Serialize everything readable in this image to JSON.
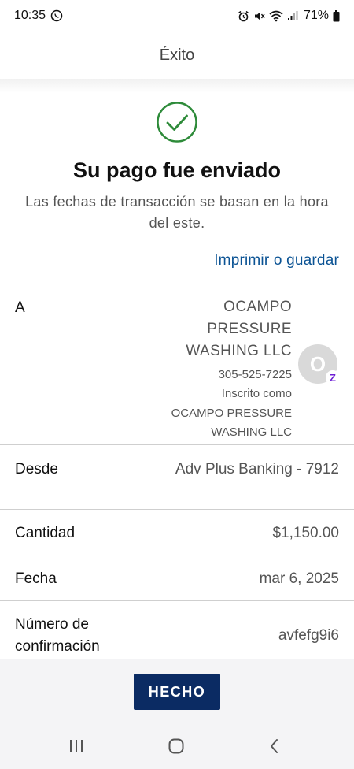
{
  "status_bar": {
    "time": "10:35",
    "battery": "71%"
  },
  "header": {
    "title": "Éxito"
  },
  "success": {
    "title": "Su pago fue enviado",
    "subtitle": "Las fechas de transacción se basan en la hora del este.",
    "print_link": "Imprimir o guardar",
    "status_color": "#2e8b3a"
  },
  "details": {
    "to": {
      "label": "A",
      "name_lines": [
        "OCAMPO",
        "PRESSURE",
        "WASHING LLC"
      ],
      "phone": "305-525-7225",
      "enrolled_lines": [
        "Inscrito como",
        "OCAMPO PRESSURE",
        "WASHING LLC"
      ],
      "avatar_initial": "O",
      "badge_letter": "Z"
    },
    "from": {
      "label": "Desde",
      "value": "Adv Plus Banking - 7912"
    },
    "amount": {
      "label": "Cantidad",
      "value": "$1,150.00"
    },
    "date": {
      "label": "Fecha",
      "value": "mar 6, 2025"
    },
    "confirmation": {
      "label": "Número de confirmación",
      "value": "avfefg9i6"
    }
  },
  "actions": {
    "done_label": "HECHO",
    "done_color": "#0b2b63"
  },
  "nav_bar": {
    "icons": [
      "recent-apps-icon",
      "home-icon",
      "back-icon"
    ]
  }
}
